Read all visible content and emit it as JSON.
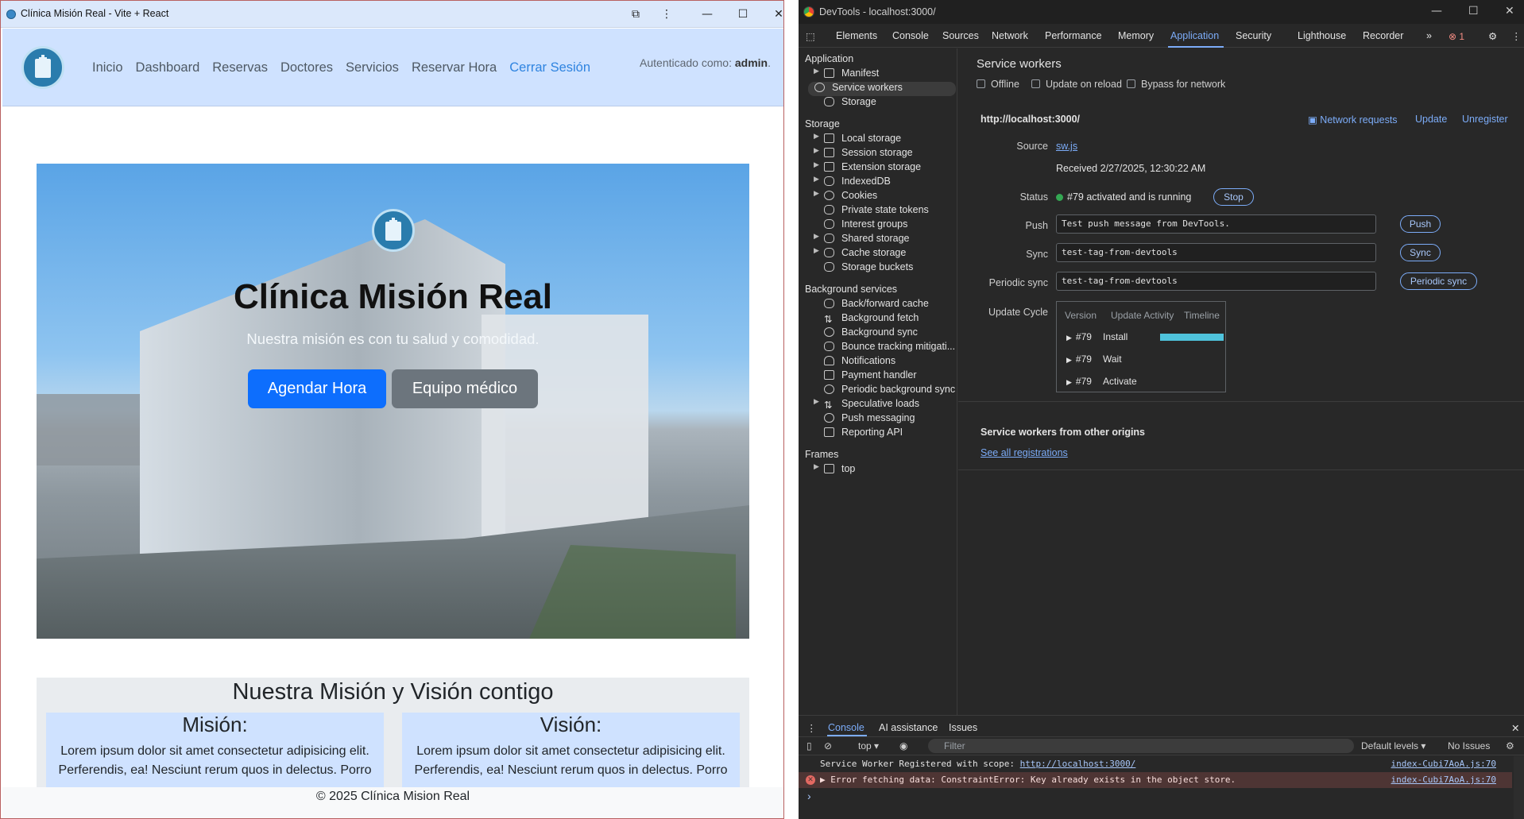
{
  "left_window": {
    "title": "Clínica Misión Real - Vite + React",
    "controls": {
      "extension": "⧉",
      "menu": "⋮",
      "minimize": "—",
      "maximize": "☐",
      "close": "✕"
    }
  },
  "app": {
    "nav": [
      "Inicio",
      "Dashboard",
      "Reservas",
      "Doctores",
      "Servicios",
      "Reservar Hora"
    ],
    "logout": "Cerrar Sesión",
    "auth_prefix": "Autenticado como:",
    "auth_user": "admin",
    "auth_suffix": "."
  },
  "hero": {
    "title": "Clínica Misión Real",
    "subtitle": "Nuestra misión es con tu salud y comodidad.",
    "primary_button": "Agendar Hora",
    "secondary_button": "Equipo médico"
  },
  "mission": {
    "title": "Nuestra Misión y Visión contigo",
    "mision_title": "Misión:",
    "mision_text": "Lorem ipsum dolor sit amet consectetur adipisicing elit. Perferendis, ea! Nesciunt rerum quos in delectus. Porro",
    "vision_title": "Visión:",
    "vision_text": "Lorem ipsum dolor sit amet consectetur adipisicing elit. Perferendis, ea! Nesciunt rerum quos in delectus. Porro"
  },
  "footer": "© 2025 Clínica Mision Real",
  "devtools": {
    "window_title": "DevTools - localhost:3000/",
    "tabs": [
      "Elements",
      "Console",
      "Sources",
      "Network",
      "Performance",
      "Memory",
      "Application",
      "Security",
      "Lighthouse",
      "Recorder"
    ],
    "active_tab": "Application",
    "more_tabs": "»",
    "error_count": "1",
    "sidebar": {
      "application_header": "Application",
      "application_items": [
        "Manifest",
        "Service workers",
        "Storage"
      ],
      "storage_header": "Storage",
      "storage_items": [
        "Local storage",
        "Session storage",
        "Extension storage",
        "IndexedDB",
        "Cookies",
        "Private state tokens",
        "Interest groups",
        "Shared storage",
        "Cache storage",
        "Storage buckets"
      ],
      "background_header": "Background services",
      "background_items": [
        "Back/forward cache",
        "Background fetch",
        "Background sync",
        "Bounce tracking mitigati...",
        "Notifications",
        "Payment handler",
        "Periodic background sync",
        "Speculative loads",
        "Push messaging",
        "Reporting API"
      ],
      "frames_header": "Frames",
      "frames_items": [
        "top"
      ]
    },
    "main": {
      "title": "Service workers",
      "checkboxes": [
        "Offline",
        "Update on reload",
        "Bypass for network"
      ],
      "origin": "http://localhost:3000/",
      "actions": [
        "Network requests",
        "Update",
        "Unregister"
      ],
      "source_label": "Source",
      "source_value": "sw.js",
      "received": "Received 2/27/2025, 12:30:22 AM",
      "status_label": "Status",
      "status_value": "#79 activated and is running",
      "stop_button": "Stop",
      "push_label": "Push",
      "push_value": "Test push message from DevTools.",
      "push_button": "Push",
      "sync_label": "Sync",
      "sync_value": "test-tag-from-devtools",
      "sync_button": "Sync",
      "periodic_label": "Periodic sync",
      "periodic_value": "test-tag-from-devtools",
      "periodic_button": "Periodic sync",
      "cycle_label": "Update Cycle",
      "cycle_headers": [
        "Version",
        "Update Activity",
        "Timeline"
      ],
      "cycle_rows": [
        {
          "version": "#79",
          "activity": "Install"
        },
        {
          "version": "#79",
          "activity": "Wait"
        },
        {
          "version": "#79",
          "activity": "Activate"
        }
      ],
      "other_origins": "Service workers from other origins",
      "see_all": "See all registrations"
    },
    "drawer": {
      "tabs": [
        "Console",
        "AI assistance",
        "Issues"
      ],
      "context": "top ▾",
      "filter": "Filter",
      "levels": "Default levels ▾",
      "issues": "No Issues",
      "log1_text": "Service Worker Registered with scope: ",
      "log1_link": "http://localhost:3000/",
      "log1_src": "index-Cubi7AoA.js:70",
      "log2_text": "▶ Error fetching data: ConstraintError: Key already exists in the object store.",
      "log2_src": "index-Cubi7AoA.js:70",
      "prompt": "›"
    }
  }
}
